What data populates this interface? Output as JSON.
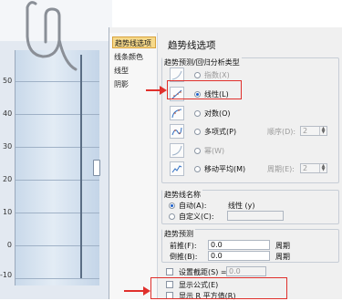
{
  "chart": {
    "y_ticks": [
      "50",
      "40",
      "30",
      "20",
      "10",
      "0",
      "-10"
    ]
  },
  "dialog": {
    "nav": [
      "趋势线选项",
      "线条颜色",
      "线型",
      "阴影"
    ],
    "section_title": "趋势线选项",
    "type_group_title": "趋势预测/回归分析类型",
    "types": [
      {
        "label": "指数(X)",
        "selected": false
      },
      {
        "label": "线性(L)",
        "selected": true
      },
      {
        "label": "对数(O)",
        "selected": false
      },
      {
        "label": "多项式(P)",
        "selected": false,
        "extra_label": "顺序(D):",
        "extra_value": "2"
      },
      {
        "label": "幂(W)",
        "selected": false
      },
      {
        "label": "移动平均(M)",
        "selected": false,
        "extra_label": "周期(E):",
        "extra_value": "2"
      }
    ],
    "name_group_title": "趋势线名称",
    "name_auto_label": "自动(A):",
    "name_auto_value": "线性 (y)",
    "name_custom_label": "自定义(C):",
    "forecast_group_title": "趋势预测",
    "forward_label": "前推(F):",
    "forward_value": "0.0",
    "forward_unit": "周期",
    "backward_label": "倒推(B):",
    "backward_value": "0.0",
    "backward_unit": "周期",
    "intercept_label": "设置截距(S) =",
    "intercept_value": "0.0",
    "show_equation_label": "显示公式(E)",
    "show_r2_label": "显示 R 平方值(R)"
  }
}
